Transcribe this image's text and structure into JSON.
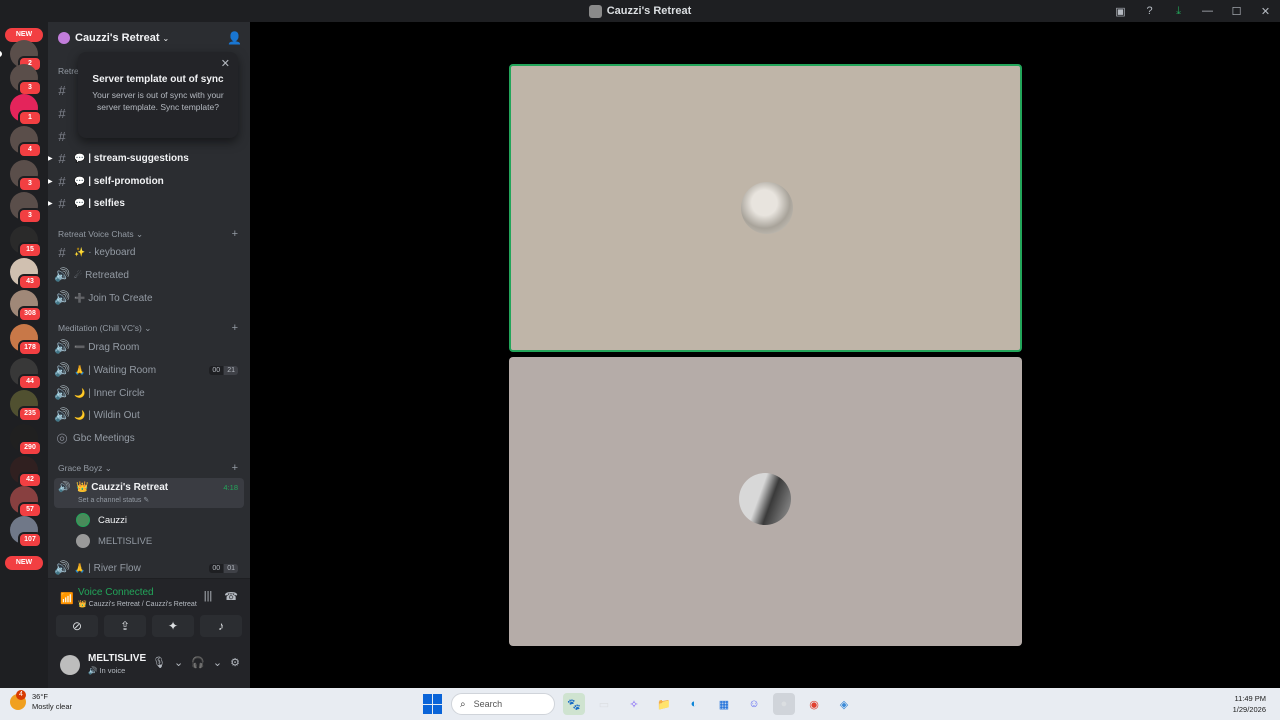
{
  "window": {
    "title": "Cauzzi's Retreat",
    "controls": [
      "—",
      "☐",
      "✕"
    ],
    "tools": [
      "screen-icon",
      "help-icon",
      "download-icon"
    ]
  },
  "server_rail": {
    "new_label": "NEW",
    "badges": [
      "2",
      "3",
      "1",
      "4",
      "3",
      "3",
      "15",
      "43",
      "308",
      "178",
      "44",
      "235",
      "290",
      "42",
      "57",
      "107"
    ],
    "new_label_bottom": "NEW"
  },
  "server": {
    "name": "Cauzzi's Retreat",
    "partial_label": "Retre"
  },
  "popup": {
    "title": "Server template out of sync",
    "body": "Your server is out of sync with your server template. Sync template?",
    "close": "✕"
  },
  "text_channels": [
    {
      "emoji": "💬",
      "name": "| stream-suggestions"
    },
    {
      "emoji": "💬",
      "name": "| self-promotion"
    },
    {
      "emoji": "💬",
      "name": "| selfies"
    }
  ],
  "categories": {
    "voice_chats": "Retreat Voice Chats",
    "meditation": "Meditation (Chill VC's)",
    "grace": "Grace Boyz"
  },
  "voice_channels": {
    "keyboard": {
      "emoji": "✨",
      "name": "· keyboard"
    },
    "retreated": {
      "emoji": "☄",
      "name": "Retreated"
    },
    "join": {
      "emoji": "➕",
      "name": "Join To Create"
    },
    "drag": {
      "emoji": "➖",
      "name": "Drag Room"
    },
    "waiting": {
      "emoji": "🙏",
      "name": "| Waiting Room",
      "count": [
        "00",
        "21"
      ]
    },
    "inner": {
      "emoji": "🌙",
      "name": "| Inner Circle"
    },
    "wildin": {
      "emoji": "🌙",
      "name": "| Wildin Out"
    },
    "gbc": {
      "name": "Gbc Meetings"
    },
    "river": {
      "emoji": "🙏",
      "name": "| River Flow",
      "count": [
        "00",
        "01"
      ]
    }
  },
  "active_channel": {
    "emoji": "👑",
    "name": "Cauzzi's Retreat",
    "status": "Set a channel status ✎",
    "time": "4:18",
    "users": [
      "Cauzzi",
      "MELTISLIVE"
    ]
  },
  "voice_panel": {
    "status": "Voice Connected",
    "location": "👑 Cauzzi's Retreat / Cauzzi's Retreat"
  },
  "user": {
    "name": "MELTISLIVE",
    "status": "🔊 In voice"
  },
  "taskbar": {
    "temp": "36°F",
    "condition": "Mostly clear",
    "weather_badge": "4",
    "search_placeholder": "Search",
    "time": "11:49 PM",
    "date": "1/29/2026"
  },
  "colors": {
    "speaking_border": "#23a55a",
    "tile1_bg": "#bfb5a8",
    "tile2_bg": "#b5aca8"
  }
}
